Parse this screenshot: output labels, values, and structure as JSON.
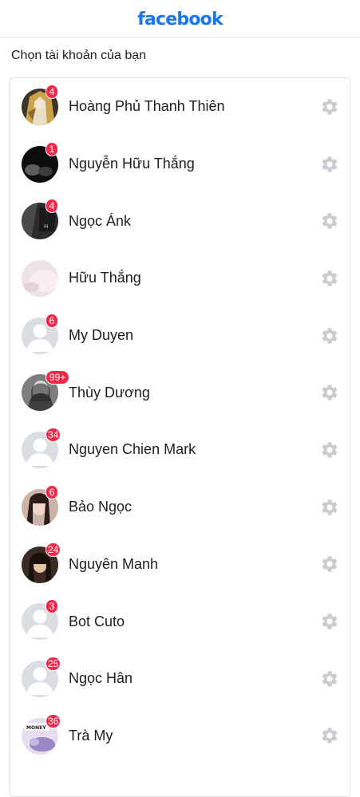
{
  "header": {
    "logo_text": "facebook",
    "brand_color": "#1877f2"
  },
  "subtitle": "Chọn tài khoản của bạn",
  "accounts": [
    {
      "name": "Hoàng Phủ Thanh Thiên",
      "badge": "4",
      "avatar": "photo-golden-hair"
    },
    {
      "name": "Nguyễn Hữu Thắng",
      "badge": "1",
      "avatar": "photo-dark"
    },
    {
      "name": "Ngọc Ánk",
      "badge": "4",
      "avatar": "photo-dark-shirt"
    },
    {
      "name": "Hữu Thắng",
      "badge": "",
      "avatar": "photo-light-pink"
    },
    {
      "name": "My Duyen",
      "badge": "6",
      "avatar": "default-profile-icon"
    },
    {
      "name": "Thùy Dương",
      "badge": "99+",
      "avatar": "photo-grayscale-portrait"
    },
    {
      "name": "Nguyen Chien Mark",
      "badge": "34",
      "avatar": "default-profile-icon"
    },
    {
      "name": "Bảo Ngọc",
      "badge": "6",
      "avatar": "photo-portrait-warm"
    },
    {
      "name": "Nguyên Manh",
      "badge": "24",
      "avatar": "photo-portrait-dark-hair"
    },
    {
      "name": "Bot Cuto",
      "badge": "3",
      "avatar": "default-profile-icon"
    },
    {
      "name": "Ngọc Hân",
      "badge": "25",
      "avatar": "default-profile-icon"
    },
    {
      "name": "Trà My",
      "badge": "36",
      "avatar": "photo-purple-sticker"
    }
  ],
  "colors": {
    "badge": "#f02849",
    "gear": "#c9ccd1",
    "text": "#1c1e21"
  }
}
